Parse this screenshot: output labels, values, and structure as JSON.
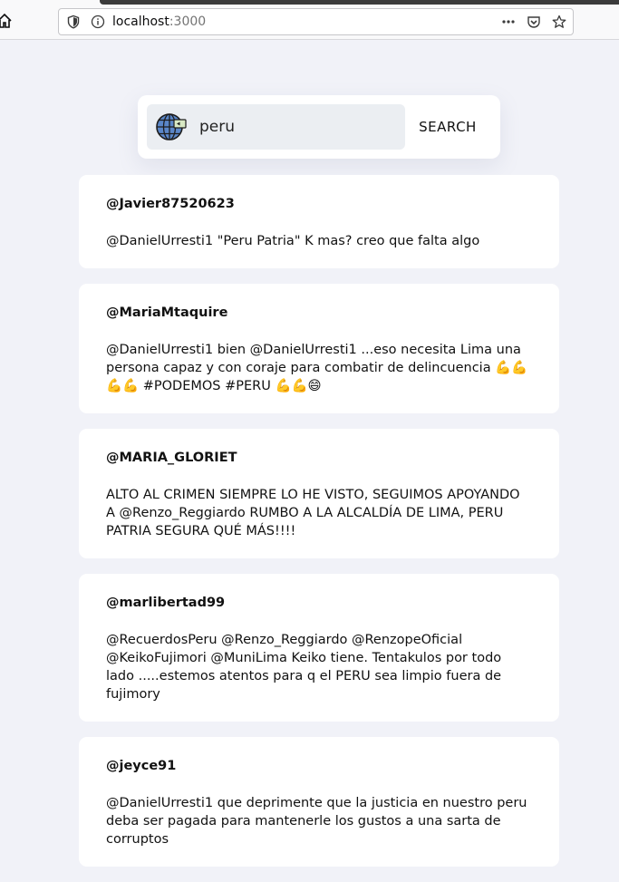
{
  "browser": {
    "url_host": "localhost",
    "url_port": ":3000"
  },
  "search": {
    "value": "peru",
    "button_label": "SEARCH"
  },
  "tweets": [
    {
      "user": "@Javier87520623",
      "text": "@DanielUrresti1 \"Peru Patria\" K mas? creo que falta algo"
    },
    {
      "user": "@MariaMtaquire",
      "text": "@DanielUrresti1 bien @DanielUrresti1 ...eso necesita Lima una persona capaz y con coraje para combatir de delincuencia 💪💪💪💪 #PODEMOS #PERU 💪💪😄"
    },
    {
      "user": "@MARIA_GLORIET",
      "text": "ALTO AL CRIMEN SIEMPRE LO HE VISTO, SEGUIMOS APOYANDO A @Renzo_Reggiardo RUMBO A LA ALCALDÍA DE LIMA, PERU PATRIA SEGURA QUÉ MÁS!!!!"
    },
    {
      "user": "@marlibertad99",
      "text": "@RecuerdosPeru @Renzo_Reggiardo @RenzopeOficial @KeikoFujimori @MuniLima Keiko tiene. Tentakulos por todo lado .....estemos atentos para q el PERU sea limpio fuera de fujimory"
    },
    {
      "user": "@jeyce91",
      "text": "@DanielUrresti1 que deprimente que la justicia en nuestro peru deba ser pagada para mantenerle los gustos a una sarta de corruptos"
    }
  ]
}
